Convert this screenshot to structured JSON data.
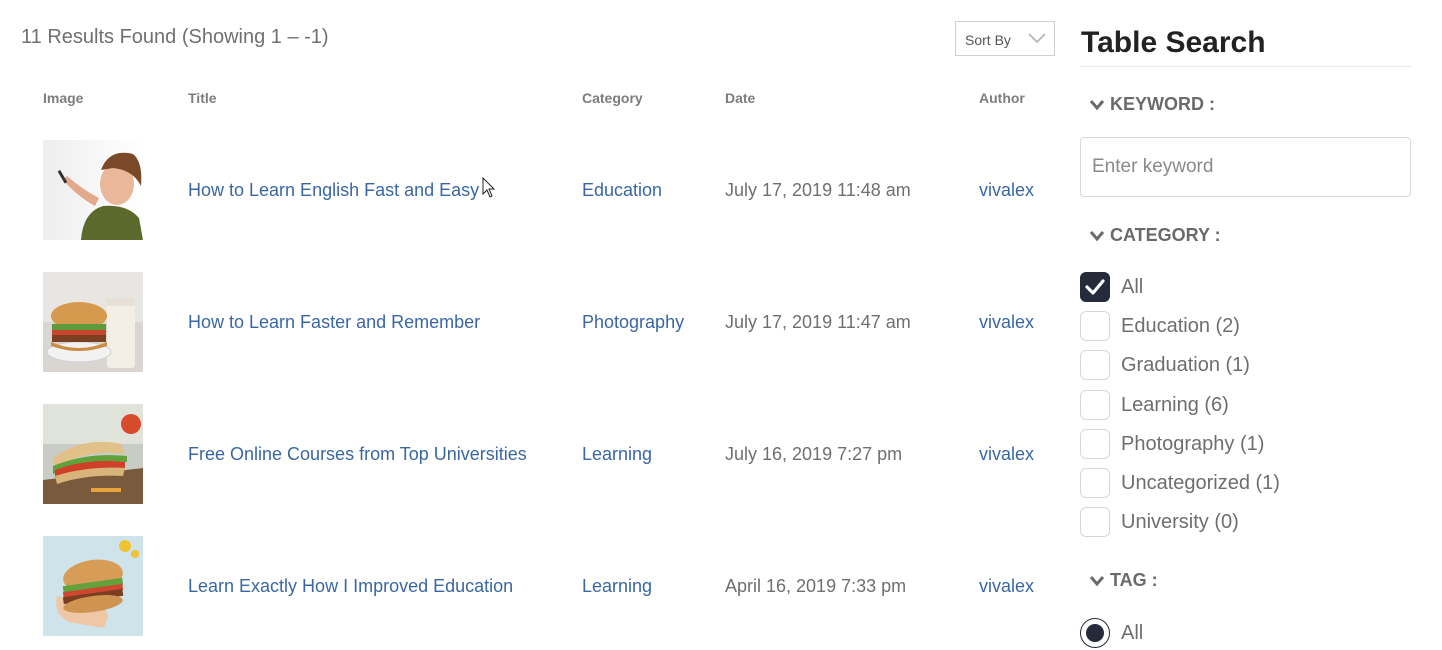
{
  "results": {
    "summary": "11 Results Found (Showing 1 – -1)"
  },
  "sort": {
    "label": "Sort By"
  },
  "table": {
    "headers": {
      "image": "Image",
      "title": "Title",
      "category": "Category",
      "date": "Date",
      "author": "Author"
    },
    "rows": [
      {
        "image": "boy-writing-on-whiteboard-photo",
        "title": "How to Learn English Fast and Easy",
        "category": "Education",
        "date": "July 17, 2019 11:48 am",
        "author": "vivalex"
      },
      {
        "image": "burger-and-milk-photo",
        "title": "How to Learn Faster and Remember",
        "category": "Photography",
        "date": "July 17, 2019 11:47 am",
        "author": "vivalex"
      },
      {
        "image": "sandwich-on-board-photo",
        "title": "Free Online Courses from Top Universities",
        "category": "Learning",
        "date": "July 16, 2019 7:27 pm",
        "author": "vivalex"
      },
      {
        "image": "hand-holding-burger-photo",
        "title": "Learn Exactly How I Improved Education",
        "category": "Learning",
        "date": "April 16, 2019 7:33 pm",
        "author": "vivalex"
      }
    ]
  },
  "sidebar": {
    "title": "Table Search",
    "keyword": {
      "heading": "KEYWORD :",
      "placeholder": "Enter keyword",
      "value": ""
    },
    "category": {
      "heading": "CATEGORY :",
      "options": [
        {
          "label": "All",
          "checked": true
        },
        {
          "label": "Education (2)",
          "checked": false
        },
        {
          "label": "Graduation (1)",
          "checked": false
        },
        {
          "label": "Learning (6)",
          "checked": false
        },
        {
          "label": "Photography (1)",
          "checked": false
        },
        {
          "label": "Uncategorized (1)",
          "checked": false
        },
        {
          "label": "University (0)",
          "checked": false
        }
      ]
    },
    "tag": {
      "heading": "TAG :",
      "options": [
        {
          "label": "All",
          "selected": true
        }
      ]
    }
  },
  "colors": {
    "link": "#3a67a3",
    "checked": "#262b3c",
    "muted_text": "#6e6e6e"
  },
  "icons": {
    "section_toggle": "chevron-down-icon",
    "check": "checkmark-icon",
    "pointer": "mouse-cursor-icon"
  }
}
